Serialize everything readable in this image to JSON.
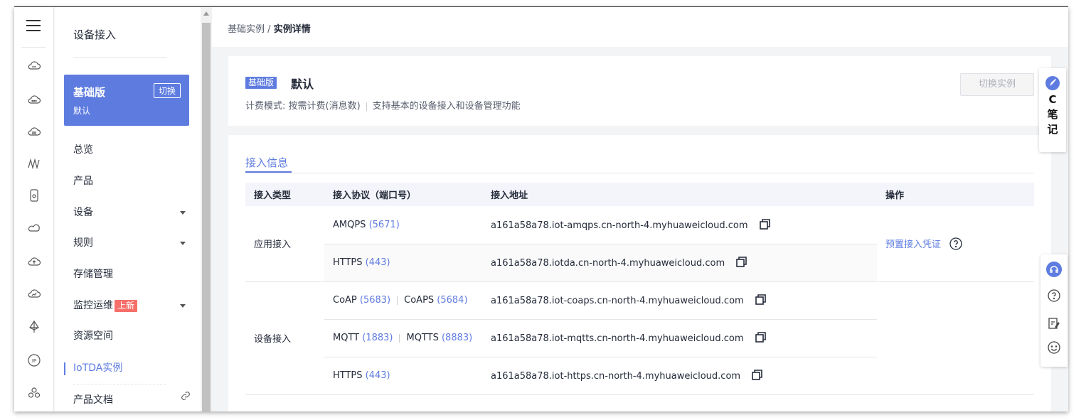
{
  "sidebar": {
    "title": "设备接入",
    "card": {
      "title": "基础版",
      "subtitle": "默认",
      "switch_label": "切换"
    },
    "items": [
      {
        "label": "总览"
      },
      {
        "label": "产品"
      },
      {
        "label": "设备"
      },
      {
        "label": "规则"
      },
      {
        "label": "存储管理"
      },
      {
        "label": "监控运维",
        "badge": "上新"
      },
      {
        "label": "资源空间"
      },
      {
        "label": "IoTDA实例"
      },
      {
        "label": "产品文档"
      }
    ]
  },
  "breadcrumb": {
    "parent": "基础实例",
    "separator": "/",
    "current": "实例详情"
  },
  "instance": {
    "tag": "基础版",
    "name": "默认",
    "billing": "计费模式: 按需计费(消息数)",
    "description": "支持基本的设备接入和设备管理功能",
    "switch_button": "切换实例"
  },
  "access": {
    "tab": "接入信息",
    "columns": [
      "接入类型",
      "接入协议（端口号）",
      "接入地址",
      "操作"
    ],
    "groups": [
      {
        "type": "应用接入",
        "operation": "预置接入凭证"
      },
      {
        "type": "设备接入"
      }
    ],
    "rows": [
      {
        "protocol": "AMQPS",
        "port": "(5671)",
        "address": "a161a58a78.iot-amqps.cn-north-4.myhuaweicloud.com"
      },
      {
        "protocol": "HTTPS",
        "port": "(443)",
        "address": "a161a58a78.iotda.cn-north-4.myhuaweicloud.com"
      },
      {
        "protocol": "CoAP",
        "port": "(5683)",
        "protocol2": "CoAPS",
        "port2": "(5684)",
        "address": "a161a58a78.iot-coaps.cn-north-4.myhuaweicloud.com"
      },
      {
        "protocol": "MQTT",
        "port": "(1883)",
        "protocol2": "MQTTS",
        "port2": "(8883)",
        "address": "a161a58a78.iot-mqtts.cn-north-4.myhuaweicloud.com"
      },
      {
        "protocol": "HTTPS",
        "port": "(443)",
        "address": "a161a58a78.iot-https.cn-north-4.myhuaweicloud.com"
      }
    ]
  },
  "note_widget": {
    "letter": "C",
    "line1": "笔",
    "line2": "记"
  },
  "colors": {
    "accent": "#5e7ce0",
    "badge": "#f66f6a"
  }
}
